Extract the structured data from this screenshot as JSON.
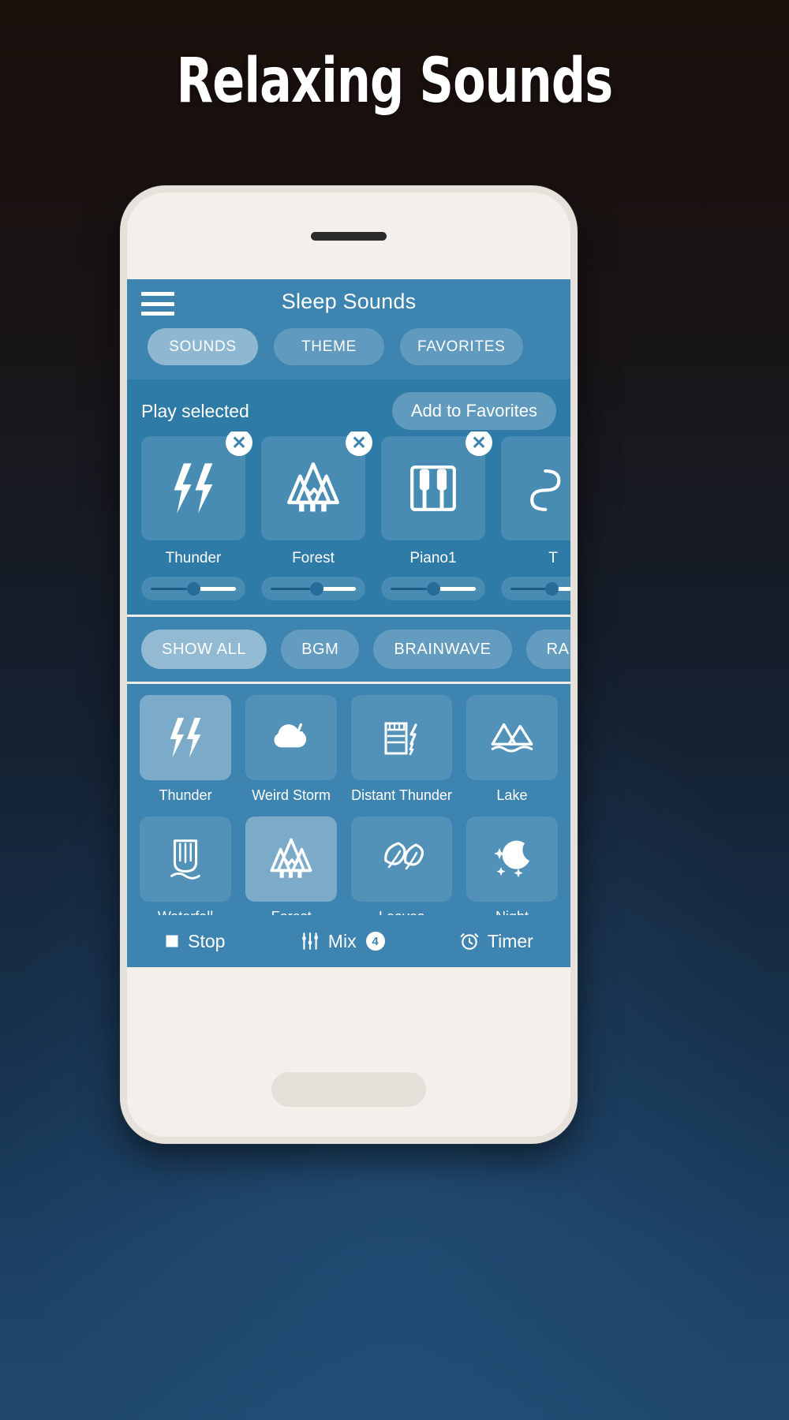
{
  "headline": "Relaxing Sounds",
  "app": {
    "title": "Sleep Sounds",
    "menu_icon": "hamburger-menu-icon",
    "accent_color": "#3d84b0",
    "panel_color": "#2e7ba8"
  },
  "tabs": [
    {
      "label": "SOUNDS",
      "active": true
    },
    {
      "label": "THEME",
      "active": false
    },
    {
      "label": "FAVORITES",
      "active": false
    }
  ],
  "selected_panel": {
    "play_selected_label": "Play selected",
    "add_to_favorites_label": "Add to Favorites",
    "close_icon": "close-circle-icon",
    "items": [
      {
        "name": "Thunder",
        "icon": "thunder-icon",
        "volume": 50
      },
      {
        "name": "Forest",
        "icon": "forest-icon",
        "volume": 52
      },
      {
        "name": "Piano1",
        "icon": "piano-icon",
        "volume": 50
      },
      {
        "name": "T",
        "icon": "wave-icon",
        "volume": 48
      }
    ]
  },
  "filters": [
    {
      "label": "SHOW ALL",
      "active": true
    },
    {
      "label": "BGM",
      "active": false
    },
    {
      "label": "BRAINWAVE",
      "active": false
    },
    {
      "label": "RA",
      "active": false
    }
  ],
  "sound_grid": [
    {
      "name": "Thunder",
      "icon": "thunder-icon",
      "selected": true
    },
    {
      "name": "Weird Storm",
      "icon": "cloud-lightning-icon",
      "selected": false
    },
    {
      "name": "Distant Thunder",
      "icon": "building-lightning-icon",
      "selected": false
    },
    {
      "name": "Lake",
      "icon": "lake-mountains-icon",
      "selected": false
    },
    {
      "name": "Waterfall",
      "icon": "waterfall-icon",
      "selected": false
    },
    {
      "name": "Forest",
      "icon": "forest-icon",
      "selected": true
    },
    {
      "name": "Leaves",
      "icon": "leaves-icon",
      "selected": false
    },
    {
      "name": "Night",
      "icon": "moon-stars-icon",
      "selected": false
    },
    {
      "name": "",
      "icon": "stream-icon",
      "selected": false
    },
    {
      "name": "",
      "icon": "waves-icon",
      "selected": false
    },
    {
      "name": "",
      "icon": "ripple-icon",
      "selected": false
    },
    {
      "name": "",
      "icon": "arch-icon",
      "selected": false
    }
  ],
  "bottom_bar": {
    "stop_label": "Stop",
    "stop_icon": "stop-square-icon",
    "mix_label": "Mix",
    "mix_icon": "mixer-icon",
    "mix_count": "4",
    "timer_label": "Timer",
    "timer_icon": "alarm-clock-icon"
  }
}
